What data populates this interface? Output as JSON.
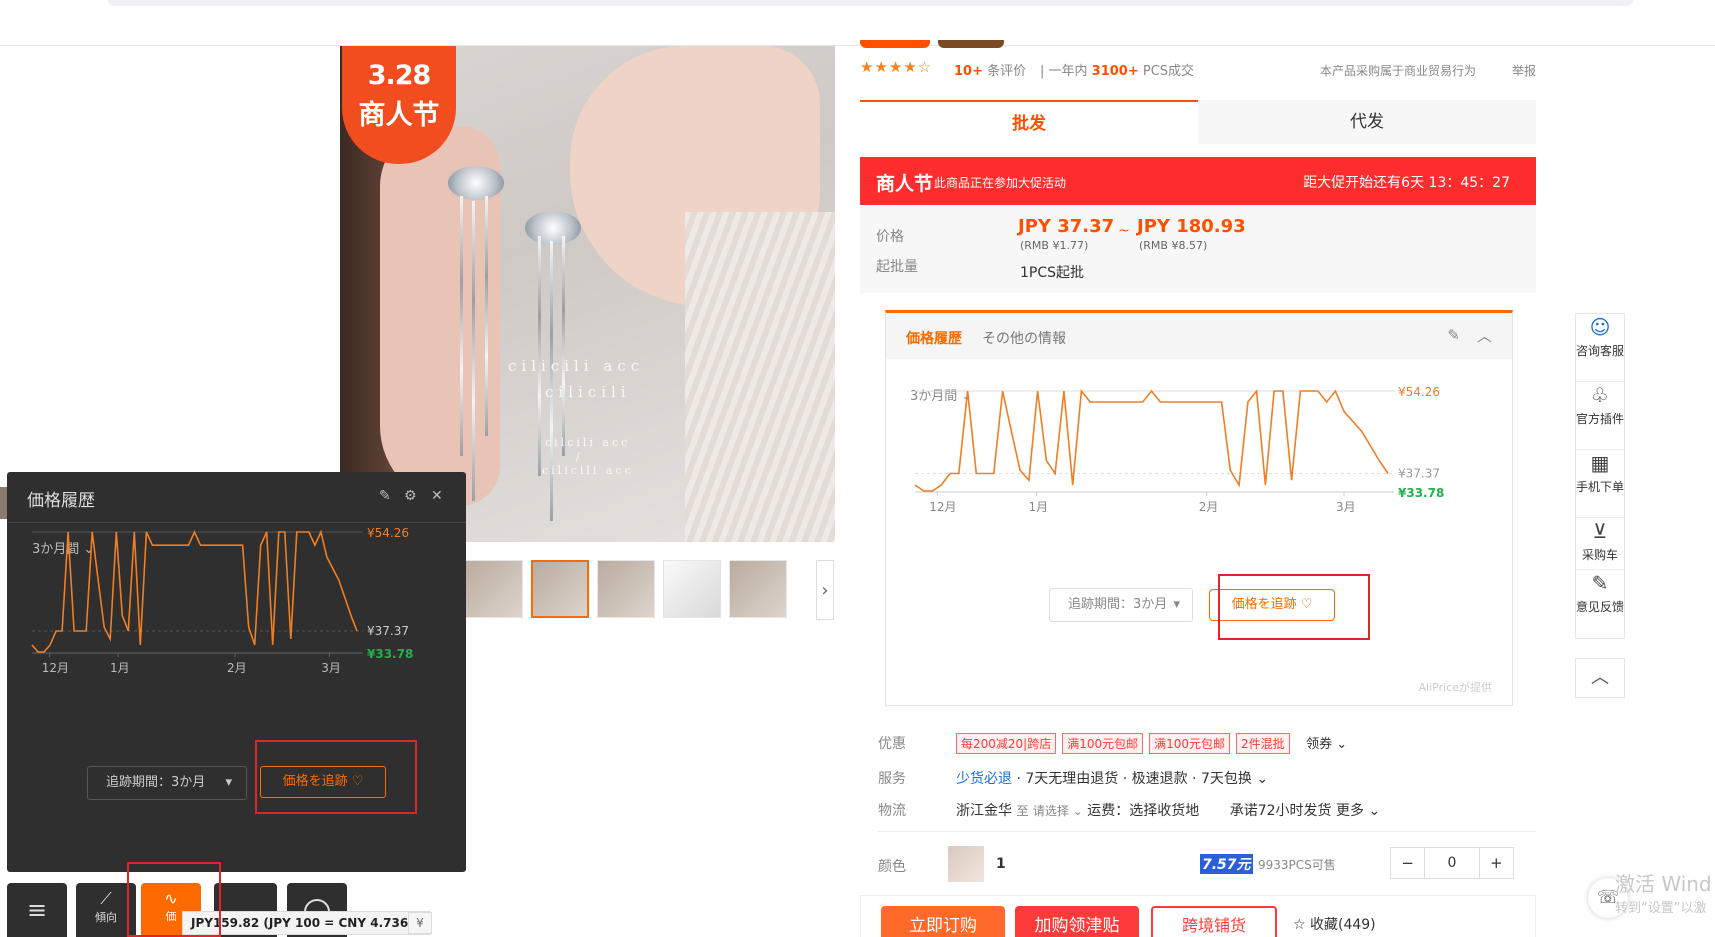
{
  "image": {
    "badge_num": "3.28",
    "badge_text": "商人节",
    "watermark1": "cilicili acc",
    "watermark2": "cilicili",
    "watermark3": "cilcili acc",
    "watermark4": "/",
    "watermark5": "cilicili acc"
  },
  "rating": {
    "stars": "★★★★☆",
    "count_num": "10+",
    "count_label": "条评价",
    "sold_prefix": "一年内",
    "sold_num": "3100+",
    "sold_suffix": "PCS成交",
    "notice": "本产品采购属于商业贸易行为",
    "report": "举报"
  },
  "tabs": [
    "批发",
    "代发"
  ],
  "promo": {
    "name": "商人节",
    "desc": "此商品正在参加大促活动",
    "countdown": "距大促开始还有6天 13：45：27"
  },
  "price": {
    "label_price": "价格",
    "label_moq": "起批量",
    "low": "JPY 37.37",
    "low_rmb": "(RMB ¥1.77)",
    "tilde": "~",
    "high": "JPY 180.93",
    "high_rmb": "(RMB ¥8.57)",
    "moq": "1PCS起批"
  },
  "aliprice": {
    "tab_history": "価格履歴",
    "tab_other": "その他の情報",
    "period": "3か月間",
    "select_label": "追跡期間：3か月",
    "track_button": "価格を追跡 ♡",
    "credit": "AliPriceが提供"
  },
  "dark_panel": {
    "title": "価格履歴",
    "period": "3か月間",
    "select_label": "追跡期間：3か月",
    "track_button": "価格を追跡 ♡"
  },
  "chart_data": {
    "type": "line",
    "x": [
      0,
      1,
      2,
      3,
      4,
      5,
      6,
      7,
      8,
      9,
      10,
      11,
      12,
      13,
      14,
      15,
      16,
      17,
      18,
      19,
      20,
      21,
      22,
      23,
      24,
      25,
      26,
      27,
      28,
      29,
      30,
      31,
      32,
      33,
      34,
      35,
      36,
      37,
      38,
      39,
      40,
      41,
      42,
      43,
      44,
      45,
      46,
      47,
      48,
      49,
      50,
      51,
      52,
      53,
      54
    ],
    "values": [
      35.0,
      33.78,
      33.78,
      35.0,
      37.37,
      37.37,
      54.26,
      37.37,
      37.37,
      37.37,
      54.26,
      46.0,
      38.0,
      36.0,
      54.26,
      40.0,
      37.37,
      54.26,
      35.0,
      54.26,
      52.0,
      52.0,
      52.0,
      52.0,
      52.0,
      52.0,
      52.0,
      54.26,
      52.0,
      52.0,
      52.0,
      52.0,
      52.0,
      52.0,
      52.0,
      52.0,
      38.0,
      35.0,
      52.0,
      54.26,
      35.0,
      54.26,
      54.26,
      36.0,
      54.26,
      54.26,
      54.26,
      52.0,
      54.26,
      50.0,
      48.0,
      46.0,
      43.0,
      40.0,
      37.37
    ],
    "x_tick_labels": [
      "12月",
      "1月",
      "2月",
      "3月"
    ],
    "y_labels": [
      "¥54.26",
      "¥37.37",
      "¥33.78"
    ],
    "ylim": [
      33.78,
      54.26
    ],
    "grid": false
  },
  "rows": {
    "discount_label": "优惠",
    "discount_tags": [
      "每200减20|跨店",
      "满100元包邮",
      "满100元包邮",
      "2件混批"
    ],
    "discount_more": "领券",
    "service_label": "服务",
    "service_link": "少货必退",
    "service_text": "· 7天无理由退货 · 极速退款 · 7天包换",
    "logistics_label": "物流",
    "logistics_from": "浙江金华",
    "logistics_to": "至",
    "logistics_choose": "请选择",
    "logistics_fee": "运费：选择收货地",
    "logistics_promise": "承诺72小时发货",
    "logistics_more": "更多",
    "color_label": "颜色",
    "color_value": "1",
    "color_price": "7.57元",
    "color_stock": "9933PCS可售",
    "qty_minus": "−",
    "qty_value": "0",
    "qty_plus": "+"
  },
  "buy_bar": {
    "buy_now": "立即订购",
    "add_cart": "加购领津贴",
    "cross_border": "跨境铺货",
    "favorite": "☆ 收藏(449)"
  },
  "sidebar": [
    {
      "icon": "☺",
      "label": "咨询客服"
    },
    {
      "icon": "♧",
      "label": "官方插件"
    },
    {
      "icon": "▦",
      "label": "手机下单"
    },
    {
      "icon": "⊻",
      "label": "采购车"
    },
    {
      "icon": "✎",
      "label": "意见反馈"
    }
  ],
  "dock": {
    "trend_label": "傾向",
    "price_label": "価",
    "rate_tip": "JPY159.82 (JPY 100 = CNY 4.7367)"
  },
  "windows": {
    "activate": "激活 Wind",
    "settings": "转到“设置”以激"
  },
  "colors": {
    "accent": "#ff6a00",
    "promo": "#ff2d2d",
    "line": "#f07e24",
    "low_price": "#22b14c"
  }
}
